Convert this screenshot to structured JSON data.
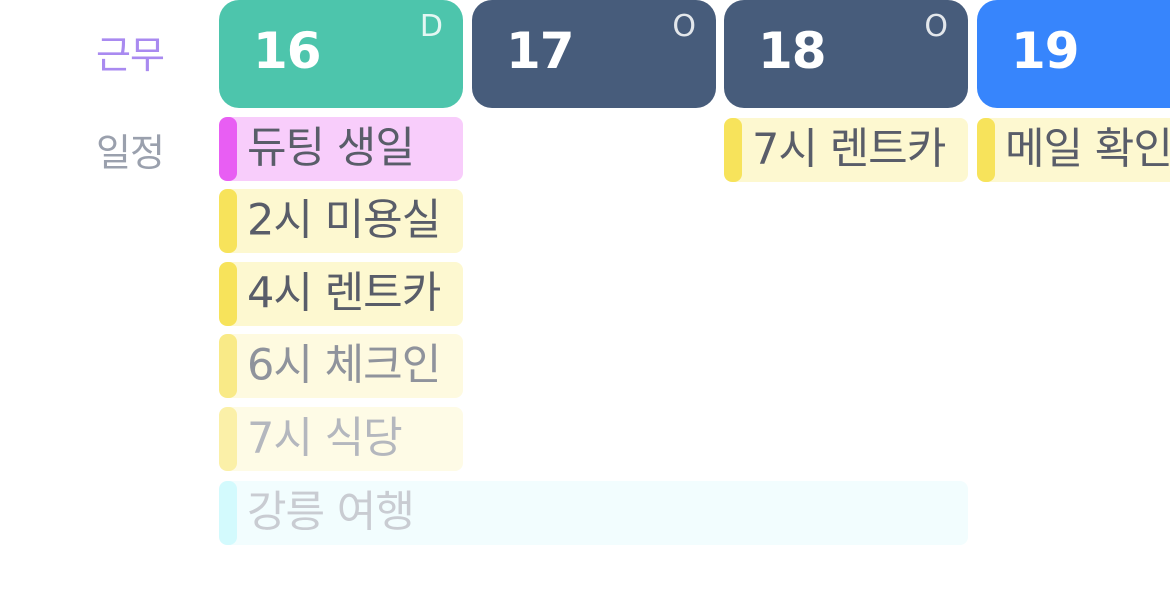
{
  "rows": {
    "work_label": "근무",
    "schedule_label": "일정"
  },
  "days": [
    {
      "date": "16",
      "shift": "D",
      "color": "#4dc5ac"
    },
    {
      "date": "17",
      "shift": "O",
      "color": "#475c7b"
    },
    {
      "date": "18",
      "shift": "O",
      "color": "#475c7b"
    },
    {
      "date": "19",
      "shift": "",
      "color": "#3785fc"
    }
  ],
  "events": [
    {
      "title": "듀팅 생일",
      "accent": "#e85ef3",
      "fill": "#f8cdfb",
      "text_color": "#595d69"
    },
    {
      "title": "2시 미용실",
      "accent": "#f7e35b",
      "fill": "#fdf8d0",
      "text_color": "#595d69"
    },
    {
      "title": "4시 렌트카",
      "accent": "#f7e35b",
      "fill": "#fdf8d0",
      "text_color": "#595d69"
    },
    {
      "title": "6시 체크인",
      "accent": "#f9ea87",
      "fill": "#fefae0",
      "text_color": "#8f939c"
    },
    {
      "title": "7시 식당",
      "accent": "#fbf0a8",
      "fill": "#fefbe6",
      "text_color": "#b4b7be"
    },
    {
      "title": "강릉 여행",
      "accent": "#d3fafd",
      "fill": "#f2fdfe",
      "text_color": "#c9ccd2"
    },
    {
      "title": "7시 렌트카",
      "accent": "#f7e35b",
      "fill": "#fdf8d0",
      "text_color": "#595d69"
    },
    {
      "title": "메일 확인",
      "accent": "#f7e35b",
      "fill": "#fdf8d0",
      "text_color": "#595d69"
    }
  ]
}
